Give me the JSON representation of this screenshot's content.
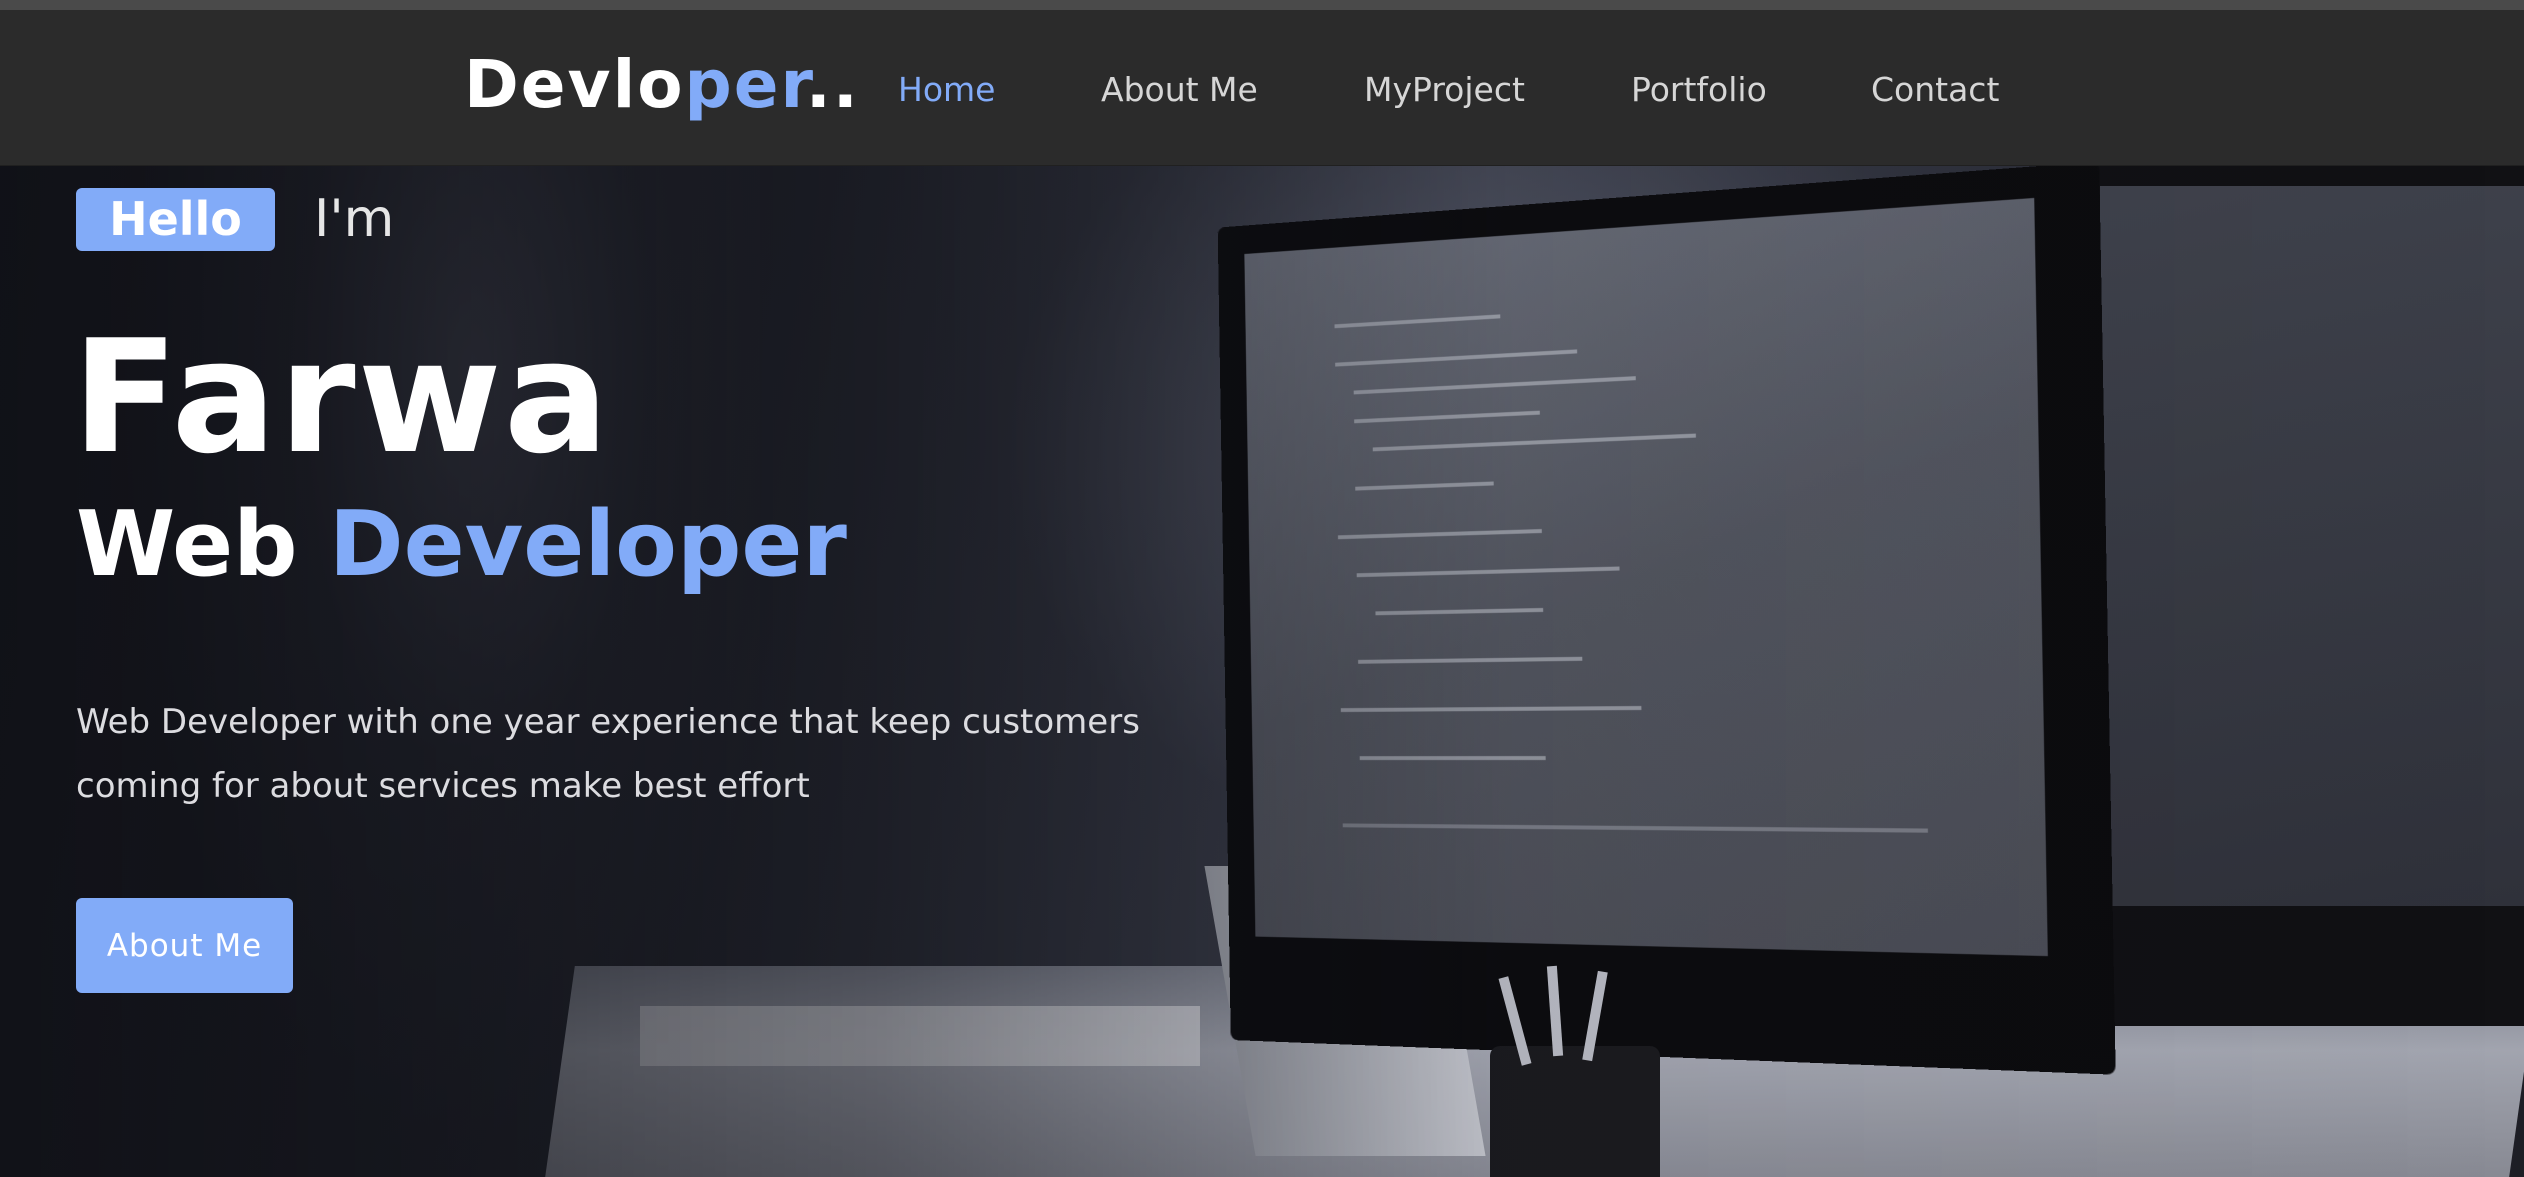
{
  "header": {
    "logo": {
      "part1": "Devlo",
      "part2": "per",
      "part3": ".."
    },
    "nav": [
      {
        "label": "Home",
        "active": true
      },
      {
        "label": "About Me",
        "active": false
      },
      {
        "label": "MyProject",
        "active": false
      },
      {
        "label": "Portfolio",
        "active": false
      },
      {
        "label": "Contact",
        "active": false
      }
    ]
  },
  "hero": {
    "badge": "Hello",
    "intro": "I'm",
    "name": "Farwa",
    "role_prefix": "Web",
    "role_highlight": "Developer",
    "description": "Web Developer with one year experience that keep customers coming for about services make best effort",
    "cta_label": "About Me",
    "background_image": "desk-with-computer-monitor-photo"
  },
  "colors": {
    "accent": "#82abf8",
    "navbar": "#2b2b2b",
    "text": "#ffffff"
  }
}
